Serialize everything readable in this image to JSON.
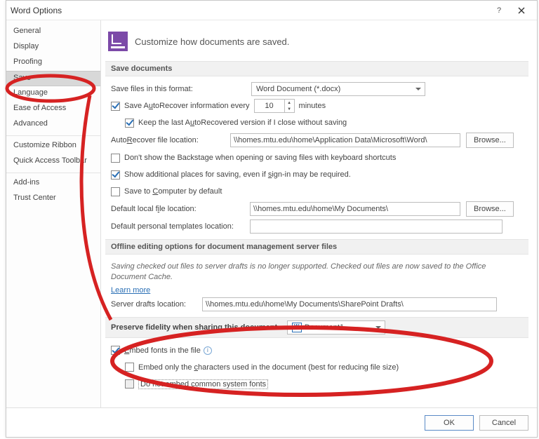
{
  "title": "Word Options",
  "sidebar": {
    "items": [
      {
        "label": "General"
      },
      {
        "label": "Display"
      },
      {
        "label": "Proofing"
      },
      {
        "label": "Save"
      },
      {
        "label": "Language"
      },
      {
        "label": "Ease of Access"
      },
      {
        "label": "Advanced"
      },
      {
        "label": "Customize Ribbon"
      },
      {
        "label": "Quick Access Toolbar"
      },
      {
        "label": "Add-ins"
      },
      {
        "label": "Trust Center"
      }
    ]
  },
  "header_desc": "Customize how documents are saved.",
  "sections": {
    "save_docs": "Save documents",
    "offline": "Offline editing options for document management server files",
    "preserve": "Preserve fidelity when sharing this document:"
  },
  "save": {
    "format_label": "Save files in this format:",
    "format_value": "Word Document (*.docx)",
    "autorec_pre": "Save AutoRecover information every",
    "autorec_mins": "10",
    "autorec_post": "minutes",
    "keep_last": "Keep the last AutoRecovered version if I close without saving",
    "autorec_loc_label": "AutoRecover file location:",
    "autorec_loc_value": "\\\\homes.mtu.edu\\home\\Application Data\\Microsoft\\Word\\",
    "browse": "Browse...",
    "dont_show": "Don't show the Backstage when opening or saving files with keyboard shortcuts",
    "show_add": "Show additional places for saving, even if sign-in may be required.",
    "save_comp": "Save to Computer by default",
    "def_local_label": "Default local file location:",
    "def_local_value": "\\\\homes.mtu.edu\\home\\My Documents\\",
    "def_tmpl_label": "Default personal templates location:",
    "def_tmpl_value": ""
  },
  "offline": {
    "msg": "Saving checked out files to server drafts is no longer supported. Checked out files are now saved to the Office Document Cache.",
    "learn": "Learn more",
    "drafts_label": "Server drafts location:",
    "drafts_value": "\\\\homes.mtu.edu\\home\\My Documents\\SharePoint Drafts\\"
  },
  "preserve": {
    "doc": "Document1",
    "embed": "Embed fonts in the file",
    "embed_only_pre": "Embed only the ",
    "embed_only_u": "c",
    "embed_only_post": "haracters used in the document (best for reducing file size)",
    "no_common": "Do not embed common system fonts"
  },
  "footer": {
    "ok": "OK",
    "cancel": "Cancel"
  }
}
